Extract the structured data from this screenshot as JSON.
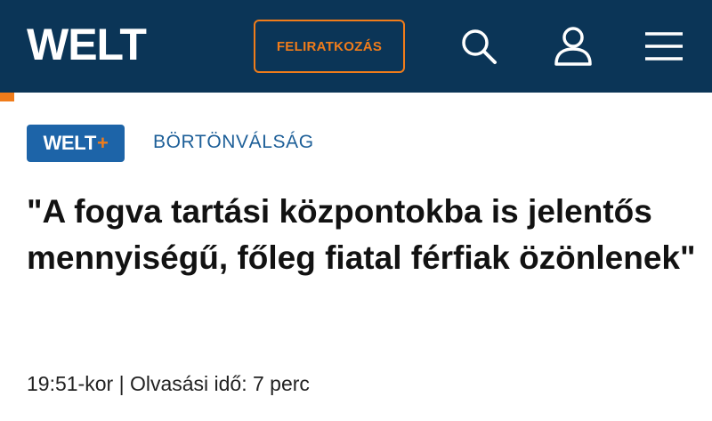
{
  "header": {
    "logo": "WELT",
    "subscribe_label": "FELIRATKOZÁS",
    "icons": [
      "search-icon",
      "user-icon",
      "menu-icon"
    ],
    "colors": {
      "background": "#0b3557",
      "accent": "#f07c1a"
    }
  },
  "article": {
    "badge": {
      "text": "WELT",
      "plus": "+"
    },
    "section": "BÖRTÖNVÁLSÁG",
    "headline": "\"A fogva tartási központokba is jelentős mennyiségű, főleg fiatal férfiak özönlenek\"",
    "time": "19:51-kor",
    "separator": "|",
    "reading_time": "Olvasási idő: 7 perc"
  }
}
